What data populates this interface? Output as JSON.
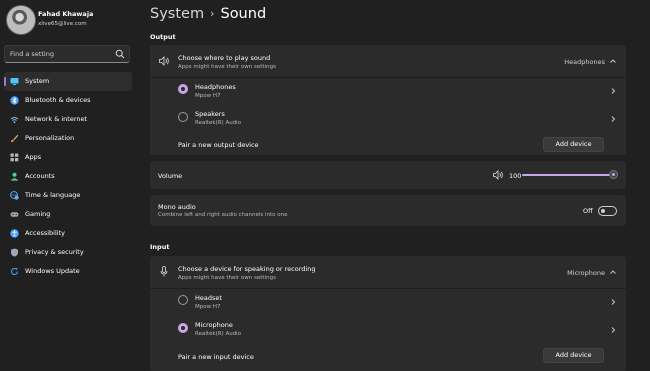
{
  "profile": {
    "name": "Fahad Khawaja",
    "email": "xlive65@live.com"
  },
  "search": {
    "placeholder": "Find a setting"
  },
  "nav": {
    "items": [
      {
        "label": "System",
        "icon": "monitor-icon",
        "color": "#4cc2ff",
        "active": true
      },
      {
        "label": "Bluetooth & devices",
        "icon": "bluetooth-icon",
        "color": "#4c9fff"
      },
      {
        "label": "Network & internet",
        "icon": "wifi-icon",
        "color": "#7ac0ff"
      },
      {
        "label": "Personalization",
        "icon": "brush-icon",
        "color": "#f0a35c"
      },
      {
        "label": "Apps",
        "icon": "apps-icon",
        "color": "#b8b8b8"
      },
      {
        "label": "Accounts",
        "icon": "person-icon",
        "color": "#47d18c"
      },
      {
        "label": "Time & language",
        "icon": "globe-clock-icon",
        "color": "#5fb2ff"
      },
      {
        "label": "Gaming",
        "icon": "gamepad-icon",
        "color": "#9fa6b0"
      },
      {
        "label": "Accessibility",
        "icon": "accessibility-icon",
        "color": "#4fa8ff"
      },
      {
        "label": "Privacy & security",
        "icon": "shield-icon",
        "color": "#9ea8b8"
      },
      {
        "label": "Windows Update",
        "icon": "update-icon",
        "color": "#38a1ff"
      }
    ]
  },
  "header": {
    "parent": "System",
    "separator": "›",
    "title": "Sound"
  },
  "output": {
    "section_label": "Output",
    "choose": {
      "title": "Choose where to play sound",
      "subtitle": "Apps might have their own settings",
      "value": "Headphones"
    },
    "devices": [
      {
        "name": "Headphones",
        "detail": "Mpow H7",
        "selected": true
      },
      {
        "name": "Speakers",
        "detail": "Realtek(R) Audio",
        "selected": false
      }
    ],
    "pair": {
      "label": "Pair a new output device",
      "button": "Add device"
    },
    "volume": {
      "label": "Volume",
      "value": "100",
      "level": 1.0
    },
    "mono": {
      "title": "Mono audio",
      "subtitle": "Combine left and right audio channels into one",
      "state": "Off"
    }
  },
  "input": {
    "section_label": "Input",
    "choose": {
      "title": "Choose a device for speaking or recording",
      "subtitle": "Apps might have their own settings",
      "value": "Microphone"
    },
    "devices": [
      {
        "name": "Headset",
        "detail": "Mpow H7",
        "selected": false
      },
      {
        "name": "Microphone",
        "detail": "Realtek(R) Audio",
        "selected": true
      }
    ],
    "pair": {
      "label": "Pair a new input device",
      "button": "Add device"
    }
  },
  "colors": {
    "accent": "#c8a3e8",
    "background": "#202020",
    "card": "#2b2b2b"
  }
}
